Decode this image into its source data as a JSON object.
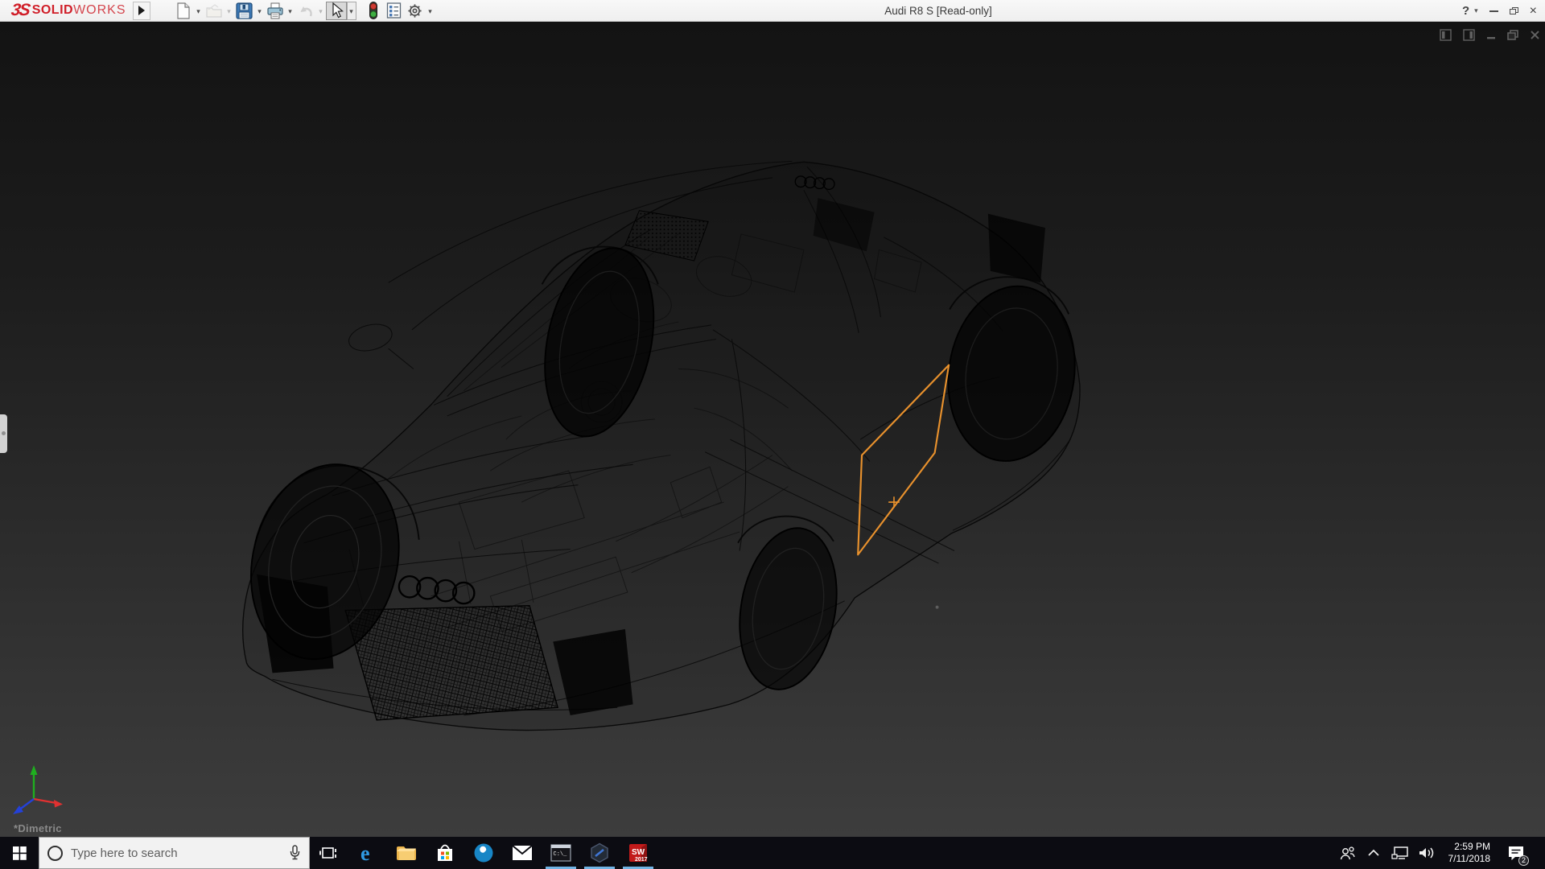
{
  "titlebar": {
    "brand_glyph": "3S",
    "brand_bold": "SOLID",
    "brand_light": "WORKS",
    "brand_color": "#d01e28",
    "title": "Audi R8 S [Read-only]",
    "help_glyph": "?",
    "toolbar_icons": [
      {
        "name": "new-document",
        "disabled": false,
        "active": false
      },
      {
        "name": "open",
        "disabled": true,
        "active": false
      },
      {
        "name": "save",
        "disabled": false,
        "active": false
      },
      {
        "name": "print",
        "disabled": false,
        "active": false
      },
      {
        "name": "undo",
        "disabled": true,
        "active": false
      },
      {
        "name": "select",
        "disabled": false,
        "active": true
      },
      {
        "name": "rebuild",
        "disabled": false,
        "active": false
      },
      {
        "name": "file-properties",
        "disabled": false,
        "active": false
      },
      {
        "name": "options",
        "disabled": false,
        "active": false
      }
    ]
  },
  "viewport": {
    "model_name": "Audi R8 S wireframe",
    "orientation_label": "*Dimetric",
    "selection_color": "#e8912d",
    "background_top": "#131313",
    "background_bottom": "#3d3d3d"
  },
  "taskbar": {
    "search_placeholder": "Type here to search",
    "apps": [
      {
        "name": "task-view",
        "running": false
      },
      {
        "name": "edge",
        "running": false,
        "icon_text": "e"
      },
      {
        "name": "file-explorer",
        "running": false
      },
      {
        "name": "microsoft-store",
        "running": false
      },
      {
        "name": "settings-wrench",
        "running": false
      },
      {
        "name": "mail",
        "running": false
      },
      {
        "name": "command-prompt",
        "running": true,
        "icon_text": "C:\\_"
      },
      {
        "name": "hexagon-app",
        "running": true
      },
      {
        "name": "solidworks-2017",
        "running": true,
        "icon_text": "SW",
        "icon_year": "2017"
      }
    ],
    "tray": {
      "time": "2:59 PM",
      "date": "7/11/2018",
      "notification_count": "2"
    }
  }
}
